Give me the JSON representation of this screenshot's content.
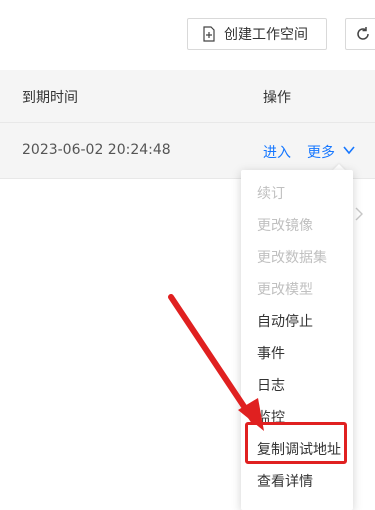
{
  "toolbar": {
    "create_label": "创建工作空间",
    "create_icon": "file-plus-icon",
    "refresh_icon": "refresh-icon"
  },
  "table": {
    "headers": [
      "到期时间",
      "操作"
    ],
    "rows": [
      {
        "expire_time": "2023-06-02 20:24:48",
        "enter_label": "进入",
        "more_label": "更多"
      }
    ]
  },
  "dropdown": {
    "items": [
      {
        "label": "续订",
        "disabled": true
      },
      {
        "label": "更改镜像",
        "disabled": true
      },
      {
        "label": "更改数据集",
        "disabled": true
      },
      {
        "label": "更改模型",
        "disabled": true
      },
      {
        "label": "自动停止",
        "disabled": false
      },
      {
        "label": "事件",
        "disabled": false
      },
      {
        "label": "日志",
        "disabled": false
      },
      {
        "label": "监控",
        "disabled": false
      },
      {
        "label": "复制调试地址",
        "disabled": false,
        "highlighted": true
      },
      {
        "label": "查看详情",
        "disabled": false
      }
    ]
  },
  "colors": {
    "link": "#1677ff",
    "annotation": "#e02020",
    "disabled": "#c0c0c0"
  }
}
